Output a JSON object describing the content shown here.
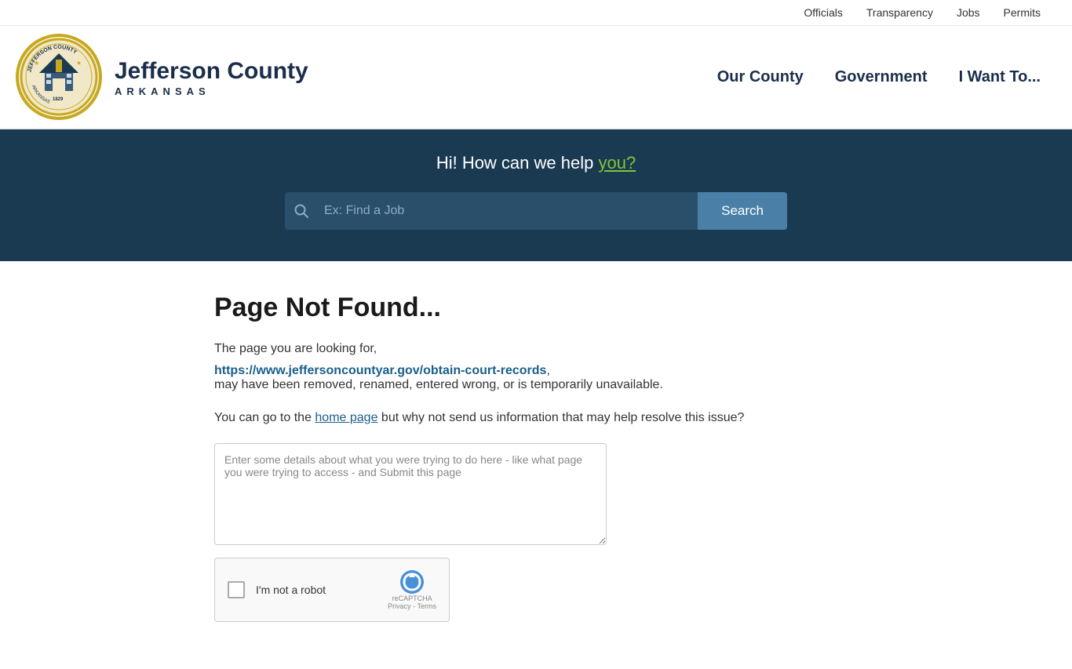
{
  "top_nav": {
    "items": [
      {
        "label": "Officials",
        "url": "#"
      },
      {
        "label": "Transparency",
        "url": "#"
      },
      {
        "label": "Jobs",
        "url": "#"
      },
      {
        "label": "Permits",
        "url": "#"
      }
    ]
  },
  "header": {
    "site_name_line1": "Jefferson County",
    "site_name_line2": "ARKANSAS",
    "logo_alt": "Jefferson County Arkansas Seal"
  },
  "main_nav": {
    "items": [
      {
        "label": "Our County",
        "url": "#"
      },
      {
        "label": "Government",
        "url": "#"
      },
      {
        "label": "I Want To...",
        "url": "#"
      }
    ]
  },
  "hero": {
    "tagline_prefix": "Hi! How can we help ",
    "tagline_highlight": "you?",
    "search_placeholder": "Ex: Find a Job",
    "search_button_label": "Search"
  },
  "error_page": {
    "title": "Page Not Found...",
    "description_line1": "The page you are looking for,",
    "missing_url": "https://www.jeffersoncountyar.gov/obtain-court-records",
    "description_line2": "may have been removed, renamed, entered wrong, or is temporarily unavailable.",
    "home_prompt_prefix": "You can go to the ",
    "home_link_label": "home page",
    "home_prompt_suffix": " but why not send us information that may help resolve this issue?",
    "feedback_placeholder": "Enter some details about what you were trying to do here - like what page you were trying to access - and Submit this page",
    "captcha_label": "I'm not a robot",
    "captcha_brand": "reCAPTCHA",
    "captcha_privacy": "Privacy - Terms"
  }
}
